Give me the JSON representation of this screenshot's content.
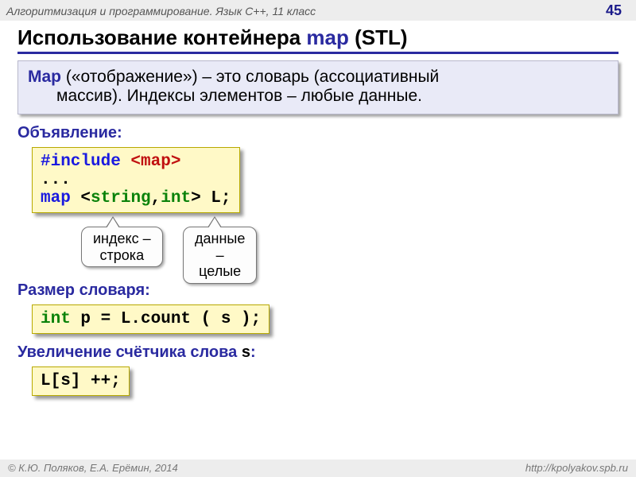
{
  "header": {
    "subject": "Алгоритмизация и программирование. Язык C++, 11 класс",
    "page": "45"
  },
  "title": {
    "prefix": "Использование контейнера ",
    "keyword": "map",
    "suffix": " (STL)"
  },
  "definition": {
    "lead": "Map",
    "line1_rest": " («отображение») – это словарь (ассоциативный",
    "line2": "массив). Индексы элементов – любые данные."
  },
  "section_declaration": "Объявление:",
  "code_decl": {
    "l1_kw": "#include",
    "l1_hdr": " <map>",
    "l2": "...",
    "l3_map": "map ",
    "l3_lt": "<",
    "l3_string": "string",
    "l3_comma": ",",
    "l3_int": "int",
    "l3_gt": ">",
    "l3_tail": " L;"
  },
  "callouts": {
    "index": {
      "l1": "индекс –",
      "l2": "строка"
    },
    "data": {
      "l1": "данные –",
      "l2": "целые"
    }
  },
  "section_size": "Размер словаря:",
  "code_size": {
    "int": "int",
    "rest": " p = L.count ( s );"
  },
  "section_incr_prefix": "Увеличение счётчика слова ",
  "section_incr_var": "s",
  "section_incr_suffix": ":",
  "code_incr": {
    "text": "L[s] ++;"
  },
  "footer": {
    "left": "© К.Ю. Поляков, Е.А. Ерёмин, 2014",
    "right": "http://kpolyakov.spb.ru"
  }
}
